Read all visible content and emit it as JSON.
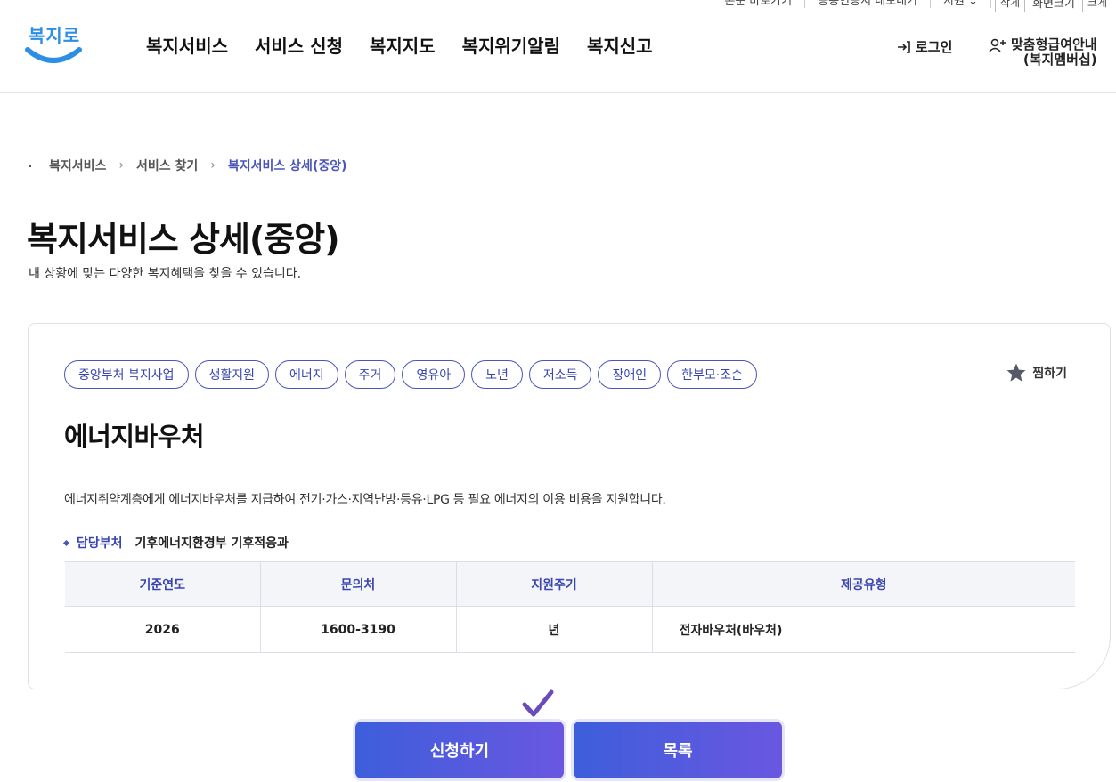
{
  "util_bar": {
    "links": [
      "본문 바로가기",
      "공동인증서 내보내기",
      "지원 ⌄"
    ],
    "zoom_small": "작게",
    "zoom_label": "화면크기",
    "zoom_large": "크게"
  },
  "header": {
    "logo_text": "복지로",
    "nav": [
      "복지서비스",
      "서비스 신청",
      "복지지도",
      "복지위기알림",
      "복지신고"
    ],
    "login_label": "로그인",
    "member_line1": "맞춤형급여안내",
    "member_line2": "(복지멤버십)"
  },
  "breadcrumb": {
    "items": [
      "복지서비스",
      "서비스 찾기",
      "복지서비스 상세(중앙)"
    ]
  },
  "page": {
    "title": "복지서비스 상세(중앙)",
    "subtitle": "내 상황에 맞는 다양한 복지혜택을 찾을 수 있습니다."
  },
  "card": {
    "tags": [
      "중앙부처 복지사업",
      "생활지원",
      "에너지",
      "주거",
      "영유아",
      "노년",
      "저소득",
      "장애인",
      "한부모·조손"
    ],
    "favorite_label": "찜하기",
    "service_title": "에너지바우처",
    "description": "에너지취약계층에게 에너지바우처를 지급하여 전기·가스·지역난방·등유·LPG 등 필요 에너지의 이용 비용을 지원합니다.",
    "dept_label": "담당부처",
    "dept_value": "기후에너지환경부 기후적응과",
    "table": {
      "headers": [
        "기준연도",
        "문의처",
        "지원주기",
        "제공유형"
      ],
      "row": [
        "2026",
        "1600-3190",
        "년",
        "전자바우처(바우처)"
      ]
    }
  },
  "buttons": {
    "apply": "신청하기",
    "list": "목록"
  },
  "colors": {
    "accent": "#3a46b0",
    "button_gradient_start": "#3d5edb",
    "button_gradient_end": "#6a57e0",
    "logo": "#2d8ee6"
  }
}
